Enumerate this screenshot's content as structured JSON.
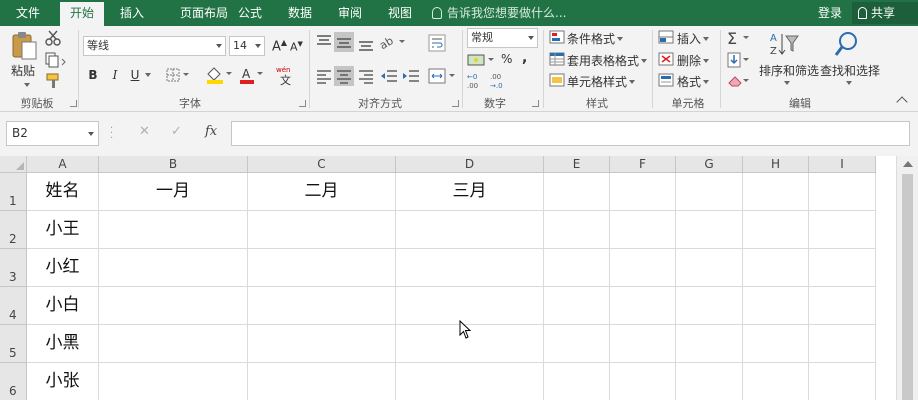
{
  "tabs": [
    "文件",
    "开始",
    "插入",
    "页面布局",
    "公式",
    "数据",
    "审阅",
    "视图"
  ],
  "active_tab": "开始",
  "tell_me": "告诉我您想要做什么...",
  "login": "登录",
  "share": "共享",
  "ribbon": {
    "clipboard": {
      "paste": "粘贴",
      "label": "剪贴板"
    },
    "font": {
      "name": "等线",
      "size": "14",
      "bold": "B",
      "italic": "I",
      "underline": "U",
      "grow": "A",
      "shrink": "A",
      "label": "字体",
      "font_color": "#e02020",
      "fill_color": "#ffd800"
    },
    "alignment": {
      "label": "对齐方式"
    },
    "number": {
      "format": "常规",
      "percent": "%",
      "comma": ",",
      "label": "数字"
    },
    "styles": {
      "conditional": "条件格式",
      "table": "套用表格格式",
      "cell": "单元格样式",
      "label": "样式"
    },
    "cells": {
      "insert": "插入",
      "delete": "删除",
      "format": "格式",
      "label": "单元格"
    },
    "editing": {
      "sort": "排序和筛选",
      "find": "查找和选择",
      "label": "编辑"
    }
  },
  "formula_bar": {
    "name_box": "B2",
    "fx": "fx",
    "value": ""
  },
  "sheet": {
    "columns": [
      "A",
      "B",
      "C",
      "D",
      "E",
      "F",
      "G",
      "H",
      "I"
    ],
    "rows": [
      [
        "姓名",
        "一月",
        "二月",
        "三月",
        "",
        "",
        "",
        "",
        ""
      ],
      [
        "小王",
        "",
        "",
        "",
        "",
        "",
        "",
        "",
        ""
      ],
      [
        "小红",
        "",
        "",
        "",
        "",
        "",
        "",
        "",
        ""
      ],
      [
        "小白",
        "",
        "",
        "",
        "",
        "",
        "",
        "",
        ""
      ],
      [
        "小黑",
        "",
        "",
        "",
        "",
        "",
        "",
        "",
        ""
      ],
      [
        "小张",
        "",
        "",
        "",
        "",
        "",
        "",
        "",
        ""
      ]
    ],
    "row_numbers": [
      "1",
      "2",
      "3",
      "4",
      "5",
      "6"
    ]
  },
  "colors": {
    "excel_green": "#217346",
    "ribbon_bg": "#f3f3f3"
  }
}
